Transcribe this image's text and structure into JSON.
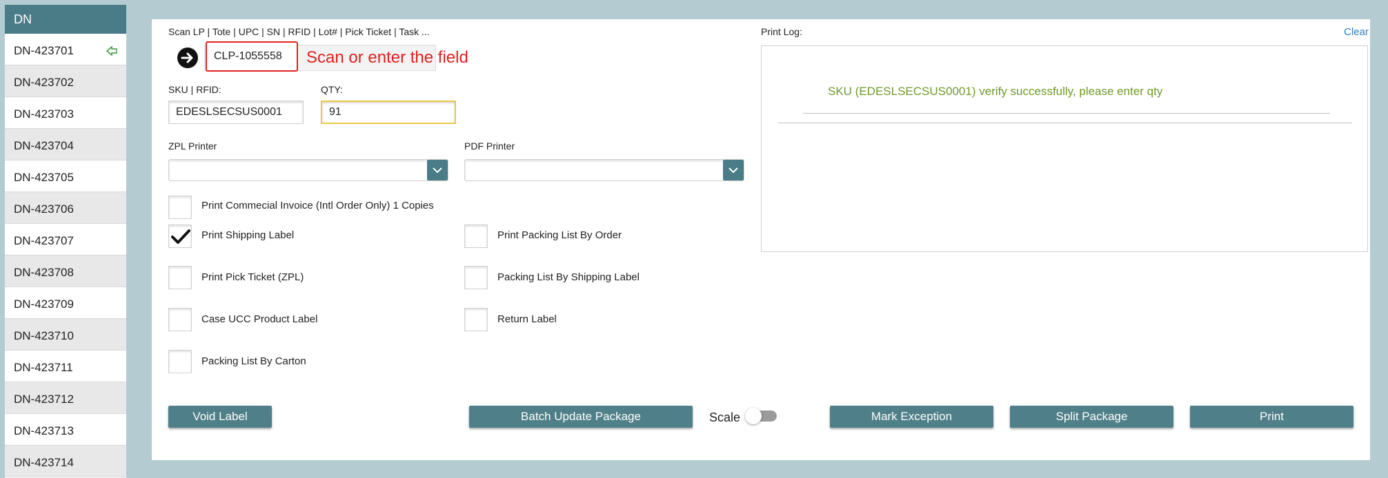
{
  "sidebar": {
    "header": "DN",
    "items": [
      {
        "label": "DN-423701",
        "icon": "upload-arrow-icon"
      },
      {
        "label": "DN-423702"
      },
      {
        "label": "DN-423703"
      },
      {
        "label": "DN-423704"
      },
      {
        "label": "DN-423705"
      },
      {
        "label": "DN-423706"
      },
      {
        "label": "DN-423707"
      },
      {
        "label": "DN-423708"
      },
      {
        "label": "DN-423709"
      },
      {
        "label": "DN-423710"
      },
      {
        "label": "DN-423711"
      },
      {
        "label": "DN-423712"
      },
      {
        "label": "DN-423713"
      },
      {
        "label": "DN-423714"
      }
    ]
  },
  "scan": {
    "label": "Scan LP | Tote | UPC | SN | RFID | Lot# | Pick Ticket | Task ...",
    "value": "CLP-1055558",
    "hint": "Scan or enter the field"
  },
  "sku": {
    "label": "SKU | RFID:",
    "value": "EDESLSECSUS0001"
  },
  "qty": {
    "label": "QTY:",
    "value": "91"
  },
  "zpl_printer": {
    "label": "ZPL Printer",
    "value": ""
  },
  "pdf_printer": {
    "label": "PDF Printer",
    "value": ""
  },
  "options": {
    "commercial_invoice": {
      "label": "Print Commecial Invoice (Intl Order Only) 1 Copies",
      "checked": false
    },
    "shipping_label": {
      "label": "Print Shipping Label",
      "checked": true
    },
    "packing_list_by_order": {
      "label": "Print Packing List By Order",
      "checked": false
    },
    "pick_ticket": {
      "label": "Print Pick Ticket (ZPL)",
      "checked": false
    },
    "packing_list_by_shipping_label": {
      "label": "Packing List By Shipping Label",
      "checked": false
    },
    "case_ucc": {
      "label": "Case UCC Product Label",
      "checked": false
    },
    "return_label": {
      "label": "Return Label",
      "checked": false
    },
    "packing_list_by_carton": {
      "label": "Packing List By Carton",
      "checked": false
    }
  },
  "buttons": {
    "void_label": "Void Label",
    "batch_update": "Batch Update Package",
    "scale": "Scale",
    "mark_exception": "Mark Exception",
    "split_package": "Split Package",
    "print": "Print"
  },
  "print_log": {
    "label": "Print Log:",
    "clear": "Clear",
    "message": "SKU (EDESLSECSUS0001) verify successfully, please enter qty"
  },
  "colors": {
    "accent": "#4a7c87",
    "success_text": "#6f9a2a",
    "hint_red": "#e02020",
    "link": "#2b7fc1"
  }
}
